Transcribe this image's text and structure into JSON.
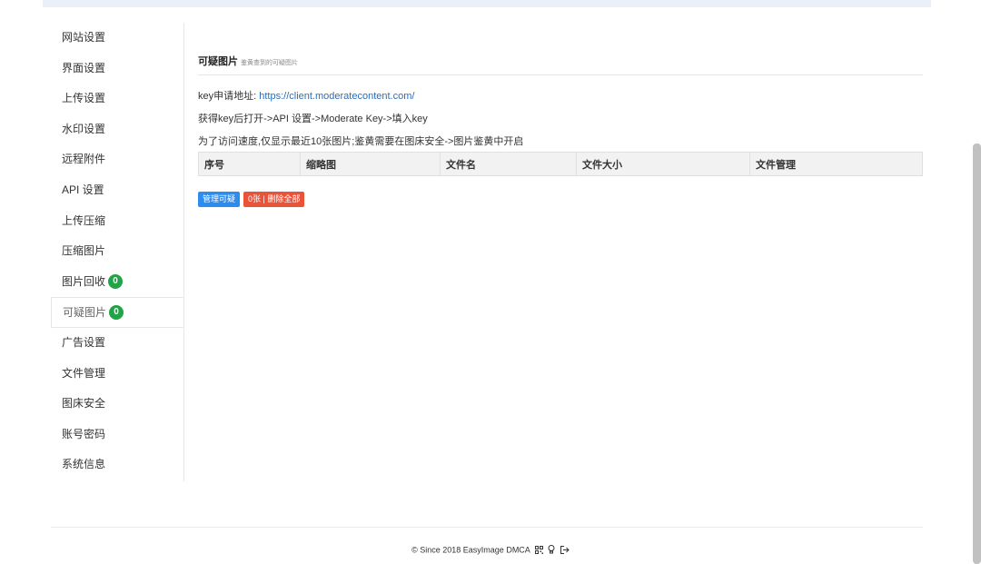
{
  "sidebar": {
    "items": [
      {
        "label": "网站设置"
      },
      {
        "label": "界面设置"
      },
      {
        "label": "上传设置"
      },
      {
        "label": "水印设置"
      },
      {
        "label": "远程附件"
      },
      {
        "label": "API 设置"
      },
      {
        "label": "上传压缩"
      },
      {
        "label": "压缩图片"
      },
      {
        "label": "图片回收",
        "badge": "0"
      },
      {
        "label": "可疑图片",
        "badge": "0",
        "active": true
      },
      {
        "label": "广告设置"
      },
      {
        "label": "文件管理"
      },
      {
        "label": "图床安全"
      },
      {
        "label": "账号密码"
      },
      {
        "label": "系统信息"
      }
    ]
  },
  "panel": {
    "title": "可疑图片",
    "subtitle": "鉴黄查到的可疑图片",
    "key_label": "key申请地址: ",
    "key_url": "https://client.moderatecontent.com/",
    "instruction": "获得key后打开->API 设置->Moderate Key->填入key",
    "note": "为了访问速度,仅显示最近10张图片;鉴黄需要在图床安全->图片鉴黄中开启"
  },
  "table": {
    "headers": [
      "序号",
      "缩略图",
      "文件名",
      "文件大小",
      "文件管理"
    ]
  },
  "buttons": {
    "manage": "管理可疑",
    "delete_all": "0张 | 删除全部"
  },
  "footer": {
    "text": "© Since 2018 EasyImage DMCA"
  },
  "colors": {
    "badge": "#23a347",
    "link": "#2a6ebc",
    "button_blue": "#2d8cf0",
    "button_red": "#e9533a"
  }
}
